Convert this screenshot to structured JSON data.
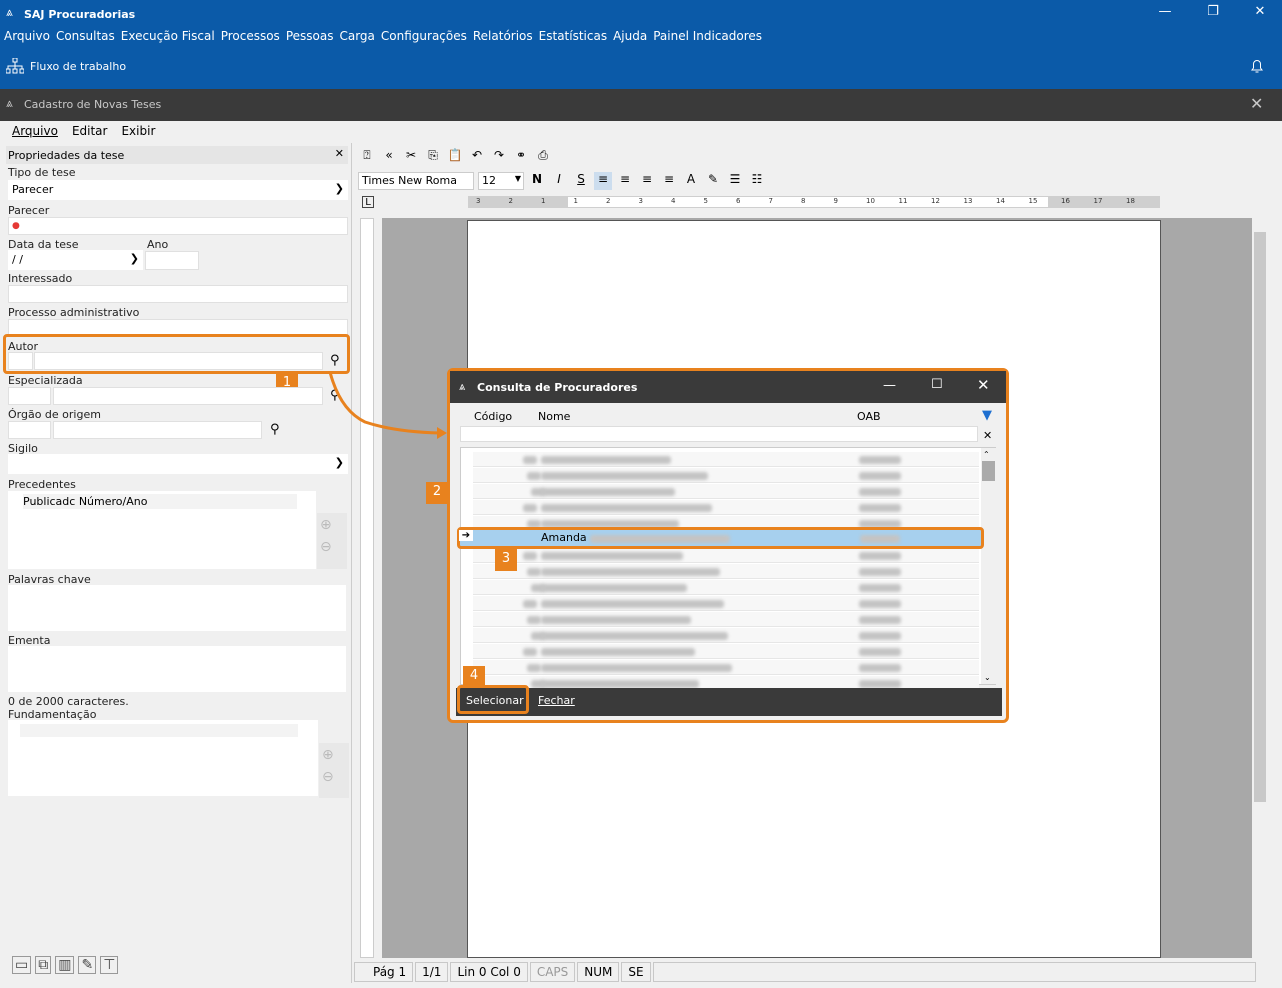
{
  "app": {
    "title": "SAJ Procuradorias",
    "menu": [
      "Arquivo",
      "Consultas",
      "Execução Fiscal",
      "Processos",
      "Pessoas",
      "Carga",
      "Configurações",
      "Relatórios",
      "Estatísticas",
      "Ajuda",
      "Painel Indicadores"
    ],
    "flow_label": "Fluxo de trabalho",
    "window_controls": {
      "min": "—",
      "max": "❐",
      "close": "✕"
    }
  },
  "window": {
    "title": "Cadastro de Novas Teses",
    "menu": [
      "Arquivo",
      "Editar",
      "Exibir"
    ]
  },
  "props": {
    "header": "Propriedades da tese",
    "tipo_label": "Tipo de tese",
    "tipo_value": "Parecer",
    "parecer_label": "Parecer",
    "data_label": "Data da tese",
    "data_value": "/ /",
    "ano_label": "Ano",
    "interessado_label": "Interessado",
    "processo_label": "Processo administrativo",
    "autor_label": "Autor",
    "especializada_label": "Especializada",
    "orgao_label": "Órgão de origem",
    "sigilo_label": "Sigilo",
    "precedentes_label": "Precedentes",
    "precedentes_cols": "Publicadc Número/Ano",
    "palavras_label": "Palavras chave",
    "ementa_label": "Ementa",
    "char_count": "0 de 2000 caracteres.",
    "fundamentacao_label": "Fundamentação"
  },
  "editor": {
    "font": "Times New Roma",
    "size": "12",
    "bold": "N",
    "italic": "I",
    "underline": "S",
    "ruler_marks": [
      "3",
      "2",
      "1",
      "1",
      "2",
      "3",
      "4",
      "5",
      "6",
      "7",
      "8",
      "9",
      "10",
      "11",
      "12",
      "13",
      "14",
      "15",
      "16",
      "17",
      "18"
    ]
  },
  "status": {
    "page": "Pág 1",
    "pages": "1/1",
    "linecol": "Lin 0 Col 0",
    "caps": "CAPS",
    "num": "NUM",
    "se": "SE"
  },
  "dialog": {
    "title": "Consulta de Procuradores",
    "col_codigo": "Código",
    "col_nome": "Nome",
    "col_oab": "OAB",
    "selected_name": "Amanda",
    "select_button": "Selecionar",
    "close_button": "Fechar"
  },
  "badges": [
    "1",
    "2",
    "3",
    "4"
  ],
  "colors": {
    "topbar": "#0b5aa8",
    "highlight": "#e8821e",
    "selected_row": "#a7d0ee"
  }
}
